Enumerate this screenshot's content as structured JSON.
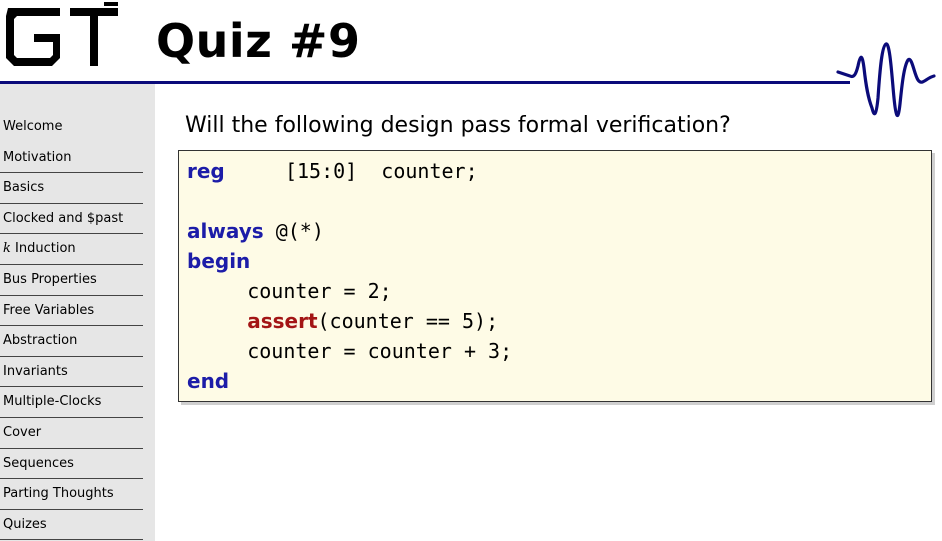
{
  "header": {
    "title": "Quiz #9"
  },
  "sidebar": {
    "items": [
      {
        "label": "Welcome"
      },
      {
        "label": "Motivation"
      },
      {
        "label": "Basics"
      },
      {
        "label": "Clocked and $past"
      },
      {
        "label_prefix": "k",
        "label": " Induction"
      },
      {
        "label": "Bus Properties"
      },
      {
        "label": "Free Variables"
      },
      {
        "label": "Abstraction"
      },
      {
        "label": "Invariants"
      },
      {
        "label": "Multiple-Clocks"
      },
      {
        "label": "Cover"
      },
      {
        "label": "Sequences"
      },
      {
        "label": "Parting Thoughts"
      },
      {
        "label": "Quizes"
      }
    ]
  },
  "main": {
    "question": "Will the following design pass formal verification?",
    "code": {
      "line1": {
        "kw": "reg",
        "rest": "     [15:0]  counter;"
      },
      "line2": {
        "kw": "always",
        "rest": " @(*)"
      },
      "line3": {
        "kw": "begin"
      },
      "line4": {
        "text": "     counter = 2;"
      },
      "line5": {
        "indent": "     ",
        "kw": "assert",
        "rest": "(counter == 5);"
      },
      "line6": {
        "text": "     counter = counter + 3;"
      },
      "line7": {
        "kw": "end"
      }
    }
  },
  "colors": {
    "header_rule": "#0b0b7a",
    "keyword": "#1c1ca8",
    "assert_keyword": "#a31515",
    "code_background": "#fefbe6",
    "sidebar_background": "#e6e6e6"
  }
}
